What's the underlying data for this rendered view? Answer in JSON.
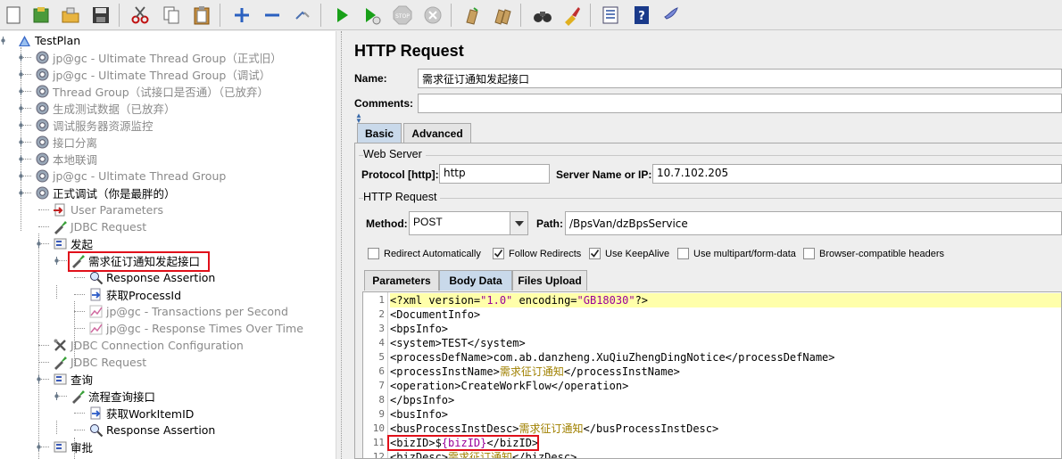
{
  "tree": {
    "root": "TestPlan",
    "items": [
      {
        "label": "jp@gc - Ultimate Thread Group（正式旧）",
        "disabled": true
      },
      {
        "label": "jp@gc - Ultimate Thread Group（调试）",
        "disabled": true
      },
      {
        "label": "Thread Group（试接口是否通）（已放弃）",
        "disabled": true
      },
      {
        "label": "生成测试数据（已放弃）",
        "disabled": true
      },
      {
        "label": "调试服务器资源监控",
        "disabled": true
      },
      {
        "label": "接口分离",
        "disabled": true
      },
      {
        "label": "本地联调",
        "disabled": true
      },
      {
        "label": "jp@gc - Ultimate Thread Group",
        "disabled": true
      },
      {
        "label": "正式调试（你是最胖的）",
        "disabled": false
      },
      {
        "label": "User Parameters",
        "disabled": true
      },
      {
        "label": "JDBC Request",
        "disabled": true
      },
      {
        "label": "发起",
        "disabled": false
      },
      {
        "label": "需求征订通知发起接口",
        "disabled": false
      },
      {
        "label": "Response Assertion",
        "disabled": false
      },
      {
        "label": "获取ProcessId",
        "disabled": false
      },
      {
        "label": "jp@gc - Transactions per Second",
        "disabled": true
      },
      {
        "label": "jp@gc - Response Times Over Time",
        "disabled": true
      },
      {
        "label": "JDBC Connection Configuration",
        "disabled": true
      },
      {
        "label": "JDBC Request",
        "disabled": true
      },
      {
        "label": "查询",
        "disabled": false
      },
      {
        "label": "流程查询接口",
        "disabled": false
      },
      {
        "label": "获取WorkItemID",
        "disabled": false
      },
      {
        "label": "Response Assertion",
        "disabled": false
      },
      {
        "label": "审批",
        "disabled": false
      }
    ]
  },
  "panel": {
    "title": "HTTP Request",
    "name_label": "Name:",
    "name_value": "需求征订通知发起接口",
    "comments_label": "Comments:",
    "comments_value": "",
    "tabs": [
      "Basic",
      "Advanced"
    ],
    "web_server": {
      "group_title": "Web Server",
      "protocol_label": "Protocol [http]:",
      "protocol_value": "http",
      "server_label": "Server Name or IP:",
      "server_value": "10.7.102.205"
    },
    "http_request": {
      "group_title": "HTTP Request",
      "method_label": "Method:",
      "method_value": "POST",
      "path_label": "Path:",
      "path_value": "/BpsVan/dzBpsService"
    },
    "checkboxes": [
      {
        "label": "Redirect Automatically",
        "checked": false
      },
      {
        "label": "Follow Redirects",
        "checked": true
      },
      {
        "label": "Use KeepAlive",
        "checked": true
      },
      {
        "label": "Use multipart/form-data",
        "checked": false
      },
      {
        "label": "Browser-compatible headers",
        "checked": false
      }
    ],
    "subtabs": [
      "Parameters",
      "Body Data",
      "Files Upload"
    ],
    "code_lines": [
      {
        "n": "1",
        "text": "<?xml version=\"1.0\" encoding=\"GB18030\"?>"
      },
      {
        "n": "2",
        "text": "<DocumentInfo>"
      },
      {
        "n": "3",
        "text": "<bpsInfo>"
      },
      {
        "n": "4",
        "text": "<system>TEST</system>"
      },
      {
        "n": "5",
        "text": "<processDefName>com.ab.danzheng.XuQiuZhengDingNotice</processDefName>"
      },
      {
        "n": "6",
        "text": "<processInstName>需求征订通知</processInstName>"
      },
      {
        "n": "7",
        "text": "<operation>CreateWorkFlow</operation>"
      },
      {
        "n": "8",
        "text": "</bpsInfo>"
      },
      {
        "n": "9",
        "text": "<busInfo>"
      },
      {
        "n": "10",
        "text": "<busProcessInstDesc>需求征订通知</busProcessInstDesc>"
      },
      {
        "n": "11",
        "text": "<bizID>${bizID}</bizID>"
      },
      {
        "n": "12",
        "text": "<bizDesc>需求征订通知</bizDesc>"
      }
    ]
  },
  "colors": {
    "highlight_box": "#e0101a",
    "active_tab": "#c9d9ea",
    "current_line": "#ffffaa"
  }
}
